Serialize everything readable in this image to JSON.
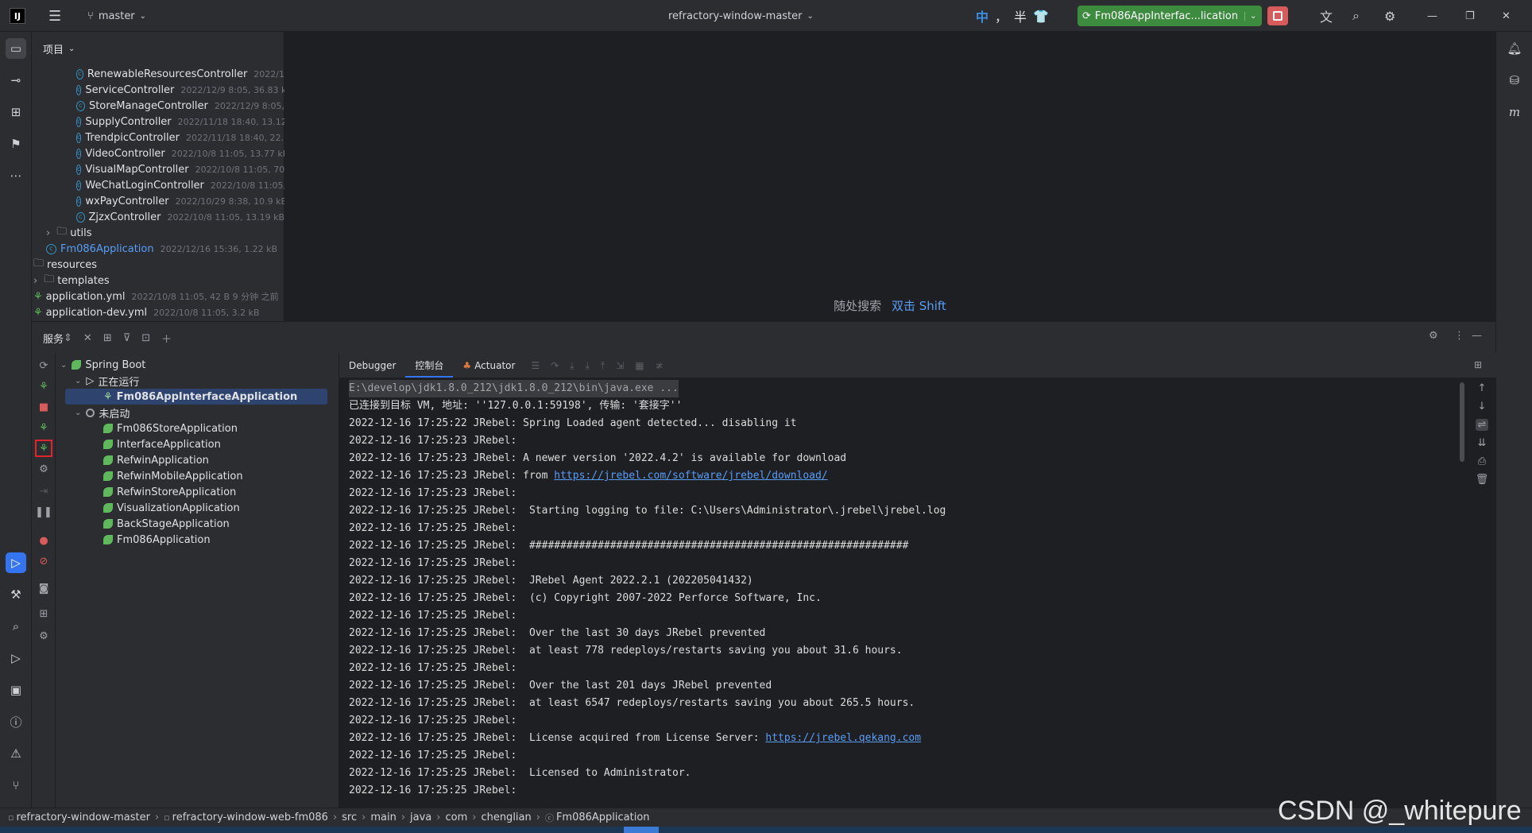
{
  "titlebar": {
    "branch": "master",
    "project": "refractory-window-master",
    "ime_labels": [
      "中",
      "，",
      "半"
    ],
    "run_config": "Fm086AppInterfac...lication"
  },
  "project_panel": {
    "title": "项目",
    "rows": [
      {
        "name": "RenewableResourcesController",
        "meta": "2022/1",
        "kind": "class",
        "indent": 2
      },
      {
        "name": "ServiceController",
        "meta": "2022/12/9 8:05, 36.83 k",
        "kind": "class",
        "indent": 2
      },
      {
        "name": "StoreManageController",
        "meta": "2022/12/9 8:05,",
        "kind": "class",
        "indent": 2
      },
      {
        "name": "SupplyController",
        "meta": "2022/11/18 18:40, 13.12 k",
        "kind": "class",
        "indent": 2
      },
      {
        "name": "TrendpicController",
        "meta": "2022/11/18 18:40, 22.7",
        "kind": "class",
        "indent": 2
      },
      {
        "name": "VideoController",
        "meta": "2022/10/8 11:05, 13.77 kB",
        "kind": "class",
        "indent": 2
      },
      {
        "name": "VisualMapController",
        "meta": "2022/10/8 11:05, 70",
        "kind": "class",
        "indent": 2
      },
      {
        "name": "WeChatLoginController",
        "meta": "2022/10/8 11:05,",
        "kind": "class",
        "indent": 2
      },
      {
        "name": "wxPayController",
        "meta": "2022/10/29 8:38, 10.9 kB",
        "kind": "class",
        "indent": 2
      },
      {
        "name": "ZjzxController",
        "meta": "2022/10/8 11:05, 13.19 kB",
        "kind": "class",
        "indent": 2
      },
      {
        "name": "utils",
        "meta": "",
        "kind": "folder",
        "indent": 1
      },
      {
        "name": "Fm086Application",
        "meta": "2022/12/16 15:36, 1.22 kB",
        "kind": "app",
        "indent": 1
      },
      {
        "name": "resources",
        "meta": "",
        "kind": "resfolder",
        "indent": 0
      },
      {
        "name": "templates",
        "meta": "",
        "kind": "folder",
        "indent": 0
      },
      {
        "name": "application.yml",
        "meta": "2022/10/8 11:05, 42 B 9 分钟 之前",
        "kind": "yml",
        "indent": 0
      },
      {
        "name": "application-dev.yml",
        "meta": "2022/10/8 11:05, 3.2 kB",
        "kind": "yml",
        "indent": 0
      }
    ]
  },
  "editor": {
    "hint_text": "随处搜索",
    "hint_shortcut": "双击 Shift"
  },
  "services": {
    "title": "服务",
    "tree": {
      "root": "Spring Boot",
      "running_group": "正在运行",
      "running": [
        "Fm086AppInterfaceApplication"
      ],
      "stopped_group": "未启动",
      "stopped": [
        "Fm086StoreApplication",
        "InterfaceApplication",
        "RefwinApplication",
        "RefwinMobileApplication",
        "RefwinStoreApplication",
        "VisualizationApplication",
        "BackStageApplication",
        "Fm086Application"
      ]
    },
    "tabs": [
      "Debugger",
      "控制台",
      "Actuator"
    ],
    "active_tab": "控制台",
    "console": [
      {
        "text": "E:\\develop\\jdk1.8.0_212\\jdk1.8.0_212\\bin\\java.exe ...",
        "link": ""
      },
      {
        "text": "已连接到目标 VM, 地址: ''127.0.0.1:59198', 传输: '套接字''",
        "link": ""
      },
      {
        "text": "2022-12-16 17:25:22 JRebel: Spring Loaded agent detected... disabling it",
        "link": ""
      },
      {
        "text": "2022-12-16 17:25:23 JRebel:",
        "link": ""
      },
      {
        "text": "2022-12-16 17:25:23 JRebel: A newer version '2022.4.2' is available for download",
        "link": ""
      },
      {
        "text": "2022-12-16 17:25:23 JRebel: from ",
        "link": "https://jrebel.com/software/jrebel/download/"
      },
      {
        "text": "2022-12-16 17:25:23 JRebel:",
        "link": ""
      },
      {
        "text": "2022-12-16 17:25:25 JRebel:  Starting logging to file: C:\\Users\\Administrator\\.jrebel\\jrebel.log",
        "link": ""
      },
      {
        "text": "2022-12-16 17:25:25 JRebel:",
        "link": ""
      },
      {
        "text": "2022-12-16 17:25:25 JRebel:  #############################################################",
        "link": ""
      },
      {
        "text": "2022-12-16 17:25:25 JRebel:",
        "link": ""
      },
      {
        "text": "2022-12-16 17:25:25 JRebel:  JRebel Agent 2022.2.1 (202205041432)",
        "link": ""
      },
      {
        "text": "2022-12-16 17:25:25 JRebel:  (c) Copyright 2007-2022 Perforce Software, Inc.",
        "link": ""
      },
      {
        "text": "2022-12-16 17:25:25 JRebel:",
        "link": ""
      },
      {
        "text": "2022-12-16 17:25:25 JRebel:  Over the last 30 days JRebel prevented",
        "link": ""
      },
      {
        "text": "2022-12-16 17:25:25 JRebel:  at least 778 redeploys/restarts saving you about 31.6 hours.",
        "link": ""
      },
      {
        "text": "2022-12-16 17:25:25 JRebel:",
        "link": ""
      },
      {
        "text": "2022-12-16 17:25:25 JRebel:  Over the last 201 days JRebel prevented",
        "link": ""
      },
      {
        "text": "2022-12-16 17:25:25 JRebel:  at least 6547 redeploys/restarts saving you about 265.5 hours.",
        "link": ""
      },
      {
        "text": "2022-12-16 17:25:25 JRebel:",
        "link": ""
      },
      {
        "text": "2022-12-16 17:25:25 JRebel:  License acquired from License Server: ",
        "link": "https://jrebel.qekang.com"
      },
      {
        "text": "2022-12-16 17:25:25 JRebel:",
        "link": ""
      },
      {
        "text": "2022-12-16 17:25:25 JRebel:  Licensed to Administrator.",
        "link": ""
      },
      {
        "text": "2022-12-16 17:25:25 JRebel:",
        "link": ""
      }
    ]
  },
  "statusbar": {
    "crumbs": [
      "refractory-window-master",
      "refractory-window-web-fm086",
      "src",
      "main",
      "java",
      "com",
      "chenglian",
      "Fm086Application"
    ]
  },
  "watermark": "CSDN @_whitepure",
  "colors": {
    "accent": "#3574f0",
    "run_green": "#3c8b3f",
    "stop_red": "#d85b5b",
    "link": "#589df6"
  }
}
